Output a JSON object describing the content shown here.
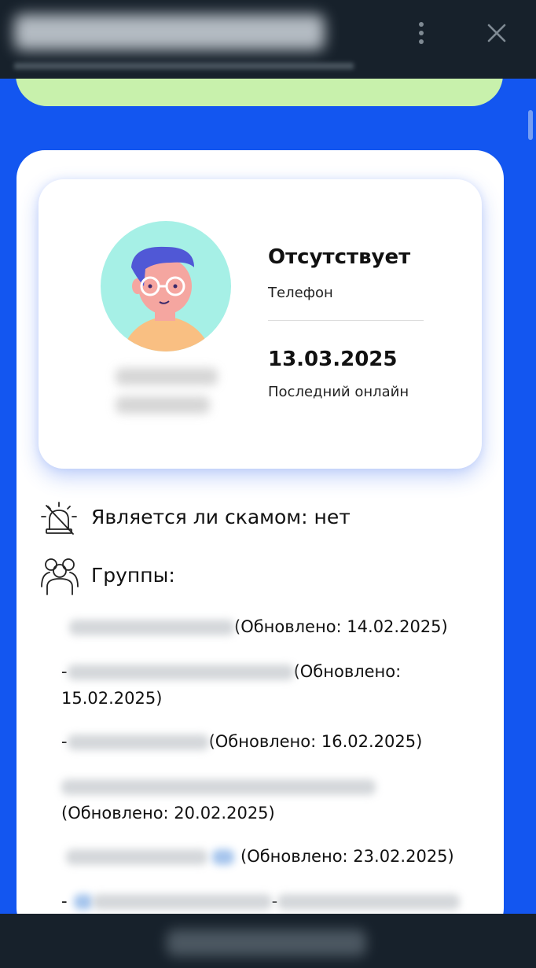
{
  "status": {
    "value": "Отсутствует",
    "label": "Телефон"
  },
  "last_online": {
    "value": "13.03.2025",
    "label": "Последний онлайн"
  },
  "scam": {
    "label": "Является ли скамом: нет",
    "icon": "siren-off-icon"
  },
  "groups": {
    "label": "Группы:",
    "icon": "users-icon",
    "items": [
      {
        "updated": "(Обновлено: 14.02.2025)"
      },
      {
        "updated": "(Обновлено:"
      },
      {
        "updated": "15.02.2025)"
      },
      {
        "updated": "(Обновлено: 16.02.2025)"
      },
      {
        "updated": "(Обновлено: 20.02.2025)"
      },
      {
        "updated": "(Обновлено: 23.02.2025)"
      }
    ]
  },
  "colors": {
    "background": "#1356F0",
    "topbar": "#17212B",
    "banner": "#C8F1AC",
    "card": "#FFFFFF",
    "avatar_bg": "#A6F0E6"
  },
  "icons": [
    "more-vert-icon",
    "close-icon",
    "avatar-illustration"
  ]
}
